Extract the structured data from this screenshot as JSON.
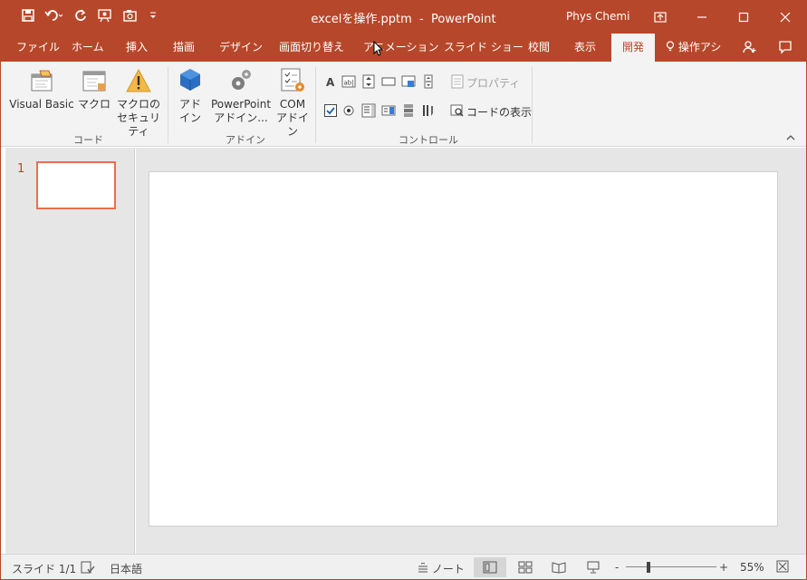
{
  "title": {
    "file_name": "excelを操作.pptm",
    "separator": "-",
    "app_name": "PowerPoint",
    "user": "Phys Chemi"
  },
  "qat": {
    "save": "save-icon",
    "undo": "undo-icon",
    "redo": "redo-icon",
    "present": "present-icon",
    "camera": "camera-icon",
    "customize": "customize-icon"
  },
  "tabs": [
    "ファイル",
    "ホーム",
    "挿入",
    "描画",
    "デザイン",
    "画面切り替え",
    "アニメーション",
    "スライド ショー",
    "校閲",
    "表示",
    "開発",
    "操作アシ"
  ],
  "active_tab": "開発",
  "ribbon": {
    "code": {
      "label": "コード",
      "visual_basic": "Visual Basic",
      "macro": "マクロ",
      "macro_security_1": "マクロの",
      "macro_security_2": "セキュリティ"
    },
    "addins": {
      "label": "アドイン",
      "addin_1": "アド",
      "addin_2": "イン",
      "pp_addin_1": "PowerPoint",
      "pp_addin_2": "アドイン...",
      "com_addin_1": "COM",
      "com_addin_2": "アドイン"
    },
    "controls": {
      "label": "コントロール",
      "properties": "プロパティ",
      "view_code": "コードの表示"
    }
  },
  "slides_panel": {
    "slide_number": "1"
  },
  "status": {
    "slide_info": "スライド 1/1",
    "language": "日本語",
    "notes": "ノート",
    "zoom": "55%",
    "zoom_minus": "-",
    "zoom_plus": "+"
  },
  "colors": {
    "accent": "#b7472a",
    "thumb_border": "#e8704d"
  }
}
